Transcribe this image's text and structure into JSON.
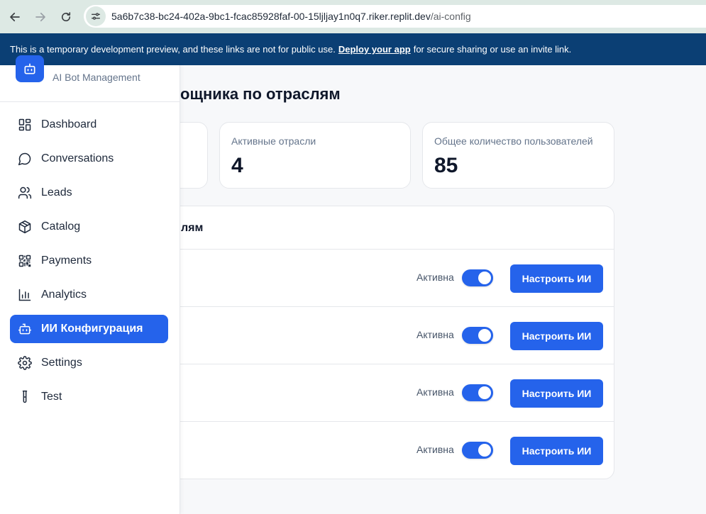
{
  "browser": {
    "url_host": "5a6b7c38-bc24-402a-9bc1-fcac85928faf-00-15ljljay1n0q7.riker.replit.dev",
    "url_path": "/ai-config"
  },
  "banner": {
    "text_before": "This is a temporary development preview, and these links are not for public use.",
    "link": "Deploy your app",
    "text_after": "for secure sharing or use an invite link."
  },
  "sidebar": {
    "subtitle": "AI Bot Management",
    "items": [
      {
        "label": "Dashboard",
        "icon": "dashboard-icon"
      },
      {
        "label": "Conversations",
        "icon": "chat-icon"
      },
      {
        "label": "Leads",
        "icon": "users-icon"
      },
      {
        "label": "Catalog",
        "icon": "package-icon"
      },
      {
        "label": "Payments",
        "icon": "qr-code-icon"
      },
      {
        "label": "Analytics",
        "icon": "bar-chart-icon"
      },
      {
        "label": "ИИ Конфигурация",
        "icon": "bot-icon",
        "active": true
      },
      {
        "label": "Settings",
        "icon": "gear-icon"
      },
      {
        "label": "Test",
        "icon": "test-tube-icon"
      }
    ]
  },
  "main": {
    "title": "ощника по отраслям",
    "stats": [
      {
        "label": "Активные отрасли",
        "value": "4"
      },
      {
        "label": "Общее количество пользователей",
        "value": "85"
      }
    ],
    "panel_title": "лям",
    "rows": [
      {
        "status": "Активна",
        "enabled": true,
        "button": "Настроить ИИ"
      },
      {
        "status": "Активна",
        "enabled": true,
        "button": "Настроить ИИ"
      },
      {
        "status": "Активна",
        "enabled": true,
        "button": "Настроить ИИ"
      },
      {
        "status": "Активна",
        "enabled": true,
        "button": "Настроить ИИ"
      }
    ]
  },
  "colors": {
    "accent": "#2563eb",
    "banner": "#0b3f74",
    "browser_bar": "#dde9e4"
  }
}
